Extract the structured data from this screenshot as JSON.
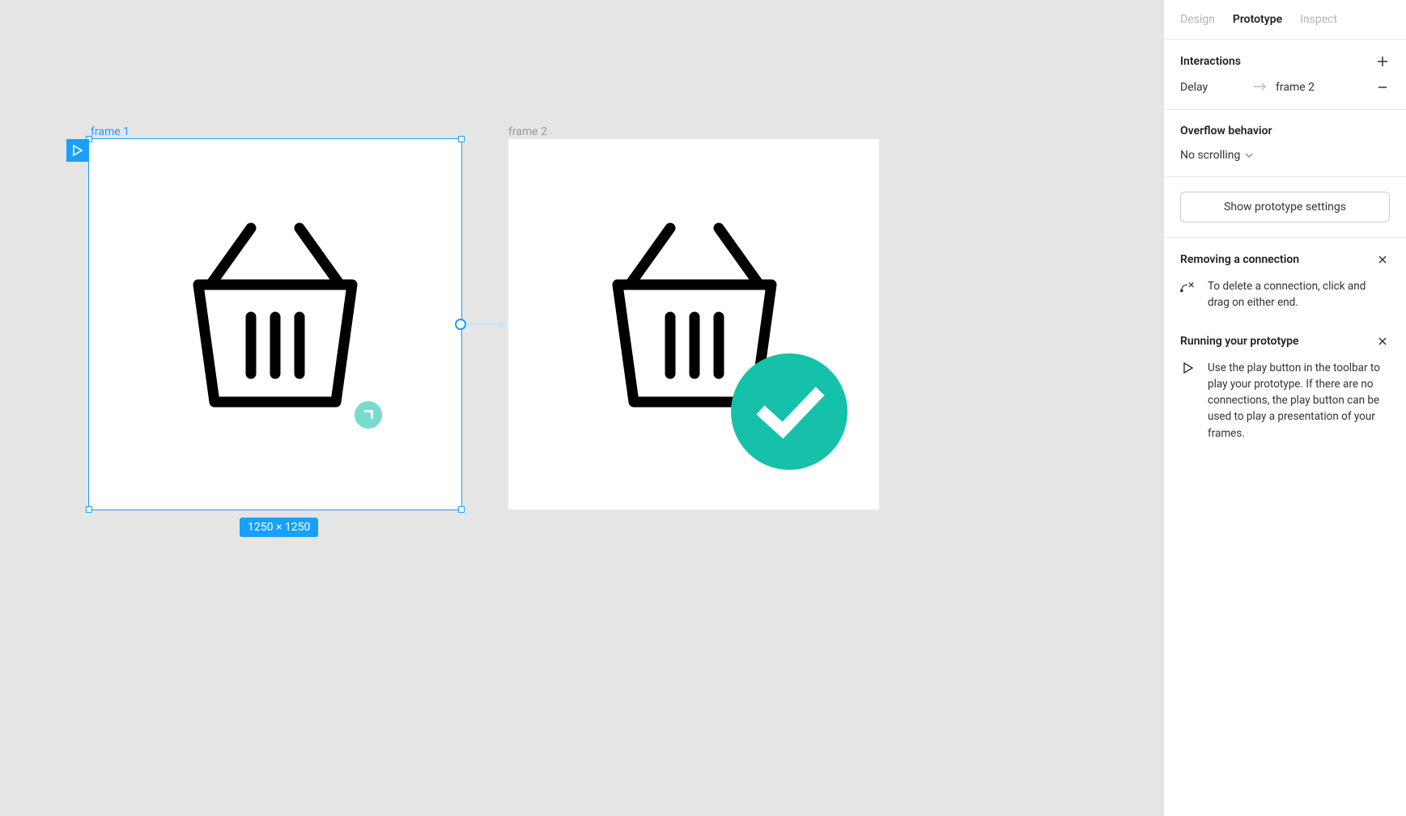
{
  "canvas": {
    "frame1": {
      "label": "frame 1"
    },
    "frame2": {
      "label": "frame 2"
    },
    "selection_dimensions": "1250 × 1250"
  },
  "sidebar": {
    "tabs": {
      "design": "Design",
      "prototype": "Prototype",
      "inspect": "Inspect"
    },
    "interactions": {
      "title": "Interactions",
      "rows": [
        {
          "trigger": "Delay",
          "destination": "frame 2"
        }
      ]
    },
    "overflow": {
      "title": "Overflow behavior",
      "value": "No scrolling"
    },
    "show_settings_label": "Show prototype settings",
    "hints": {
      "removing": {
        "title": "Removing a connection",
        "body": "To delete a connection, click and drag on either end."
      },
      "running": {
        "title": "Running your prototype",
        "body": "Use the play button in the toolbar to play your prototype. If there are no connections, the play button can be used to play a presentation of your frames."
      }
    }
  }
}
